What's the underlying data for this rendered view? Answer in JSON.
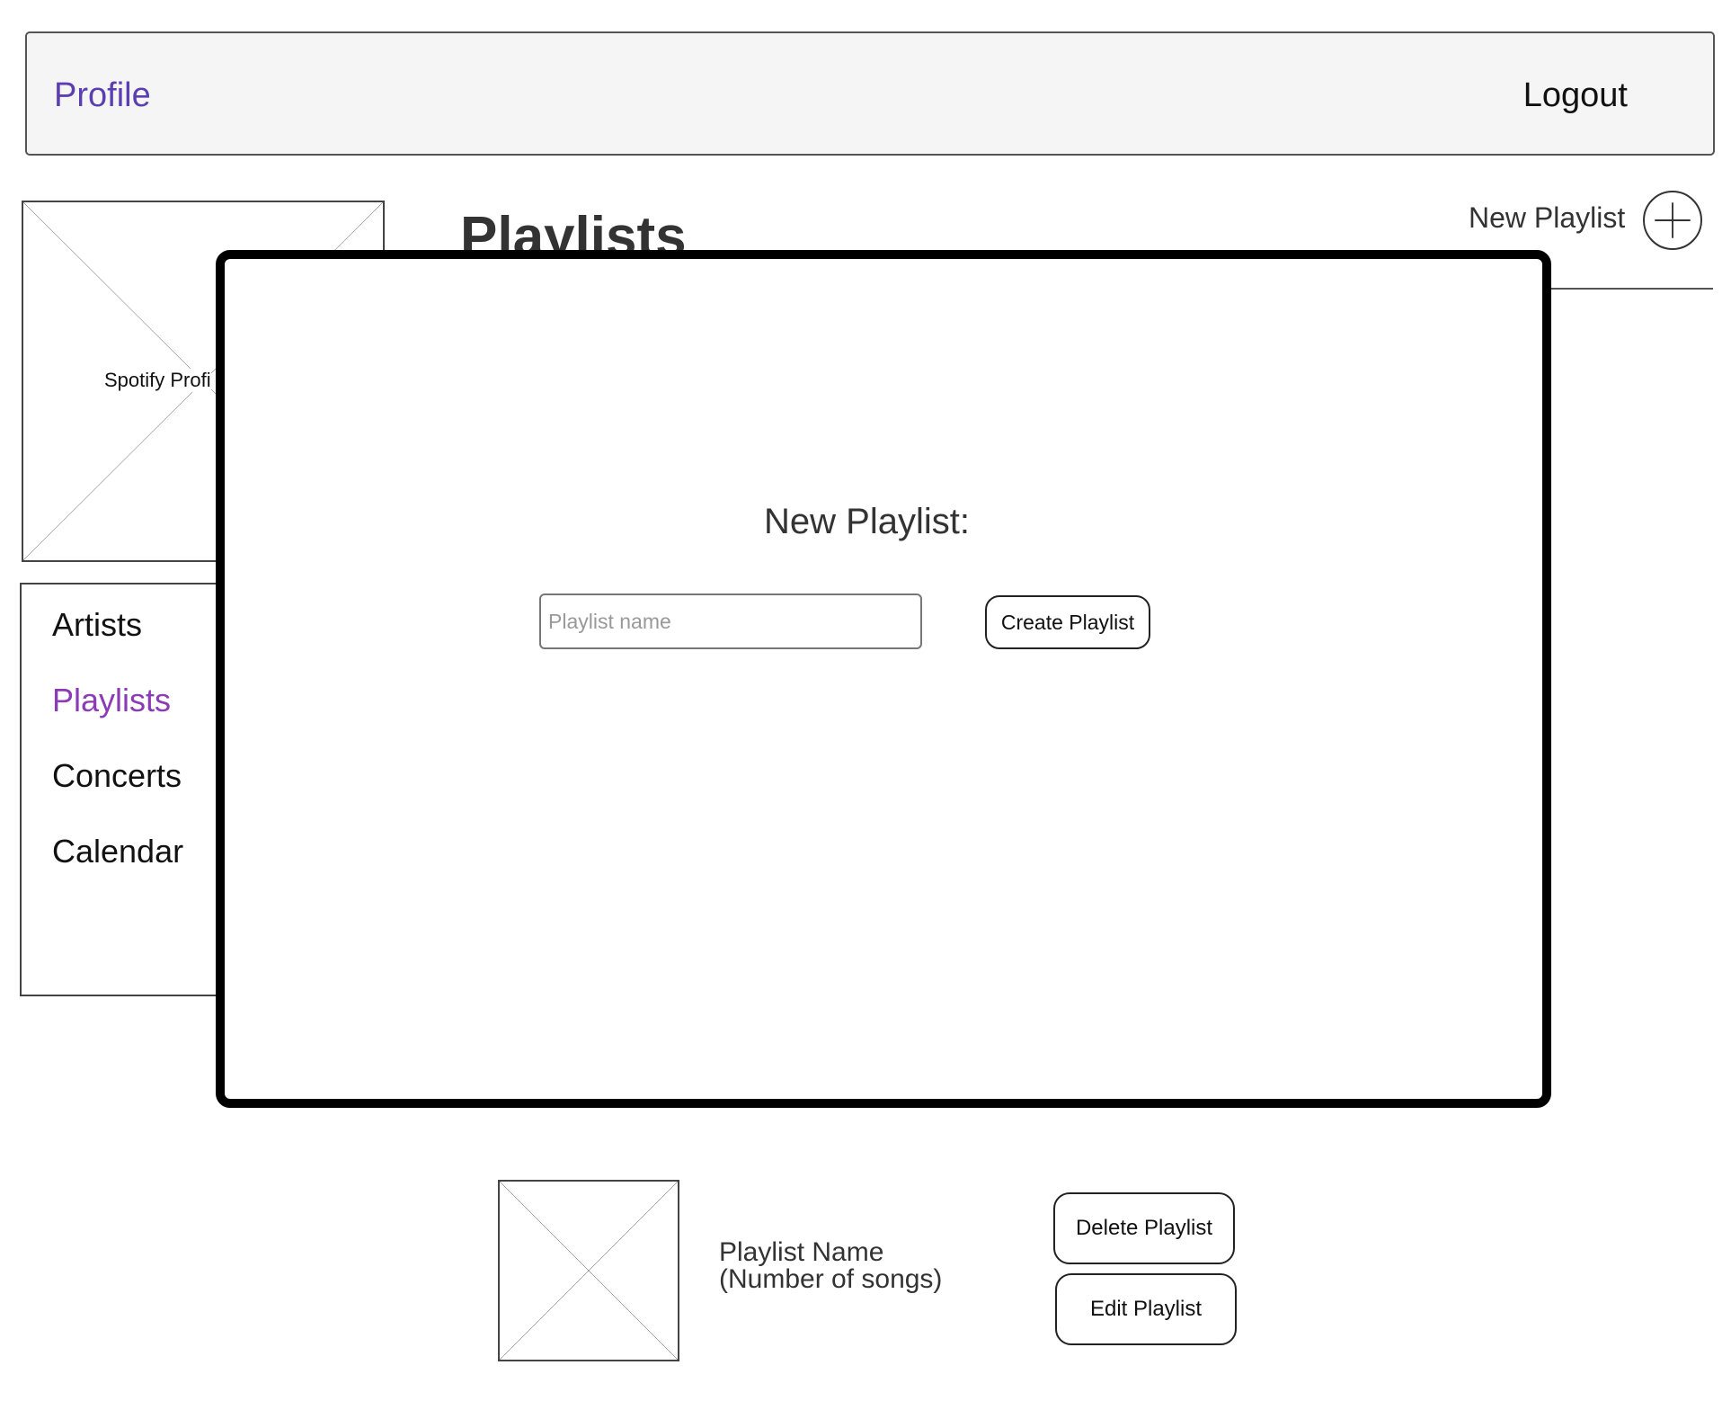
{
  "header": {
    "profile_label": "Profile",
    "logout_label": "Logout"
  },
  "profile_image": {
    "label": "Spotify Profi",
    "icon": "image-placeholder-icon"
  },
  "sidebar": {
    "items": [
      {
        "label": "Artists",
        "active": false
      },
      {
        "label": "Playlists",
        "active": true
      },
      {
        "label": "Concerts",
        "active": false
      },
      {
        "label": "Calendar",
        "active": false
      }
    ]
  },
  "main": {
    "title": "Playlists",
    "new_playlist_label": "New Playlist",
    "new_playlist_icon": "plus-circle-icon"
  },
  "playlist_row": {
    "name": "Playlist Name",
    "song_count": "(Number of songs)",
    "delete_label": "Delete Playlist",
    "edit_label": "Edit Playlist"
  },
  "modal": {
    "title": "New Playlist:",
    "input_placeholder": "Playlist name",
    "input_value": "",
    "create_label": "Create Playlist"
  },
  "colors": {
    "profile_link": "#5b3fb0",
    "active_nav": "#8a3bb5",
    "header_bg": "#f5f5f5",
    "modal_border": "#000000"
  }
}
